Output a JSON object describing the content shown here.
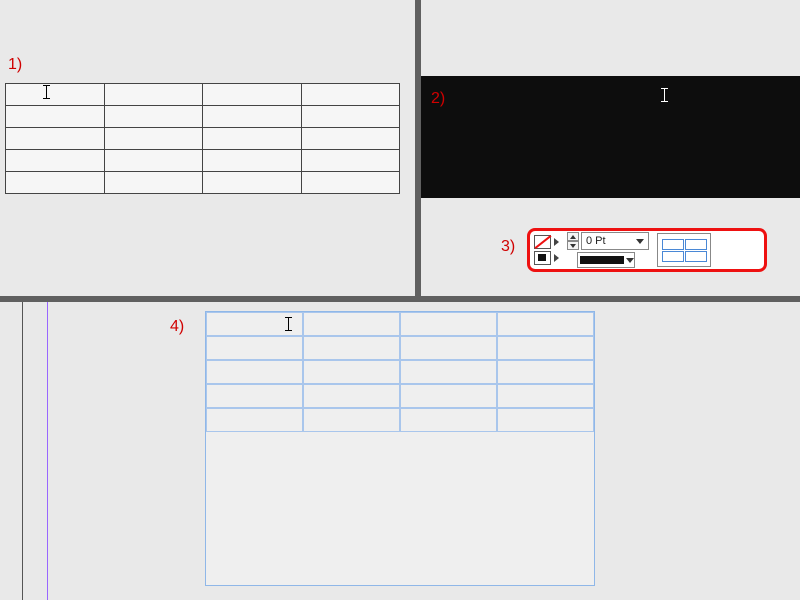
{
  "steps": {
    "one": "1)",
    "two": "2)",
    "three": "3)",
    "four": "4)"
  },
  "toolbar": {
    "stroke_weight": "0 Pt"
  }
}
